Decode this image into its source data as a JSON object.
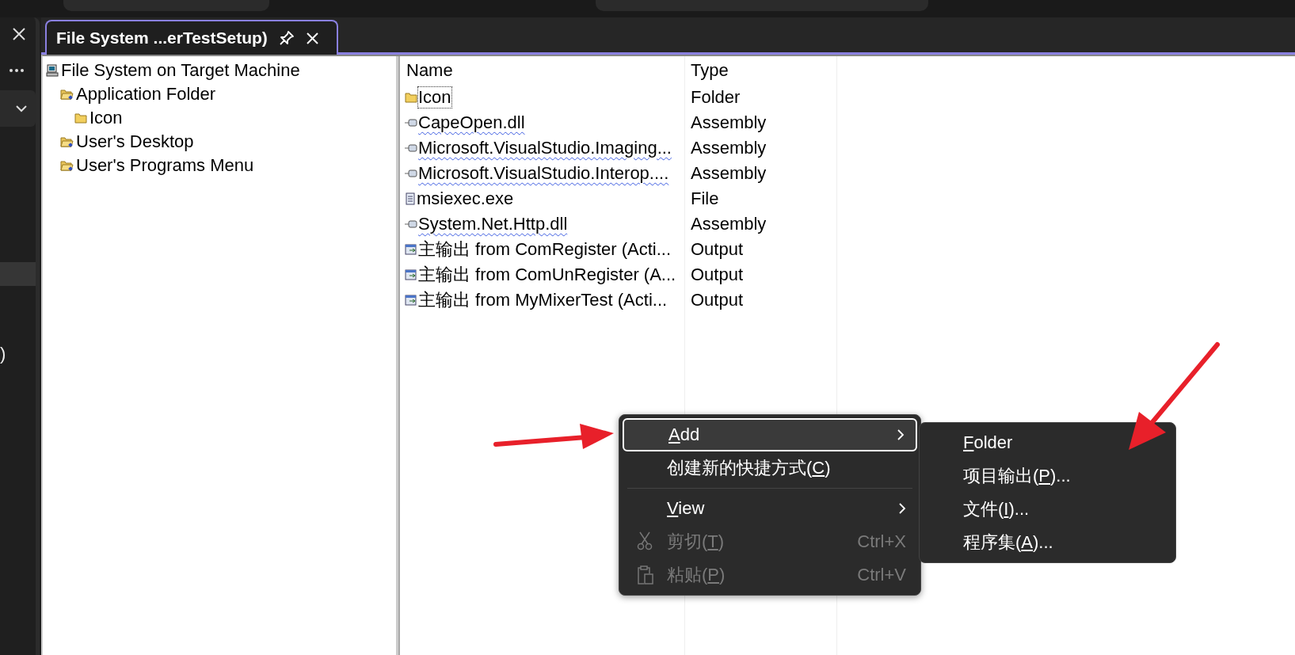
{
  "side_panel": {
    "text": ")"
  },
  "document_tab": {
    "title": "File System ...erTestSetup)",
    "selected": true
  },
  "tree": [
    {
      "label": "File System on Target Machine",
      "kind": "computer",
      "children": [
        {
          "label": "Application Folder",
          "kind": "special-folder",
          "children": [
            {
              "label": "Icon",
              "kind": "folder"
            }
          ]
        },
        {
          "label": "User's Desktop",
          "kind": "special-folder"
        },
        {
          "label": "User's Programs Menu",
          "kind": "special-folder"
        }
      ]
    }
  ],
  "table": {
    "columns": [
      "Name",
      "Type"
    ],
    "rows": [
      {
        "name": "Icon",
        "type": "Folder",
        "kind": "folder",
        "focused": true,
        "warning": false
      },
      {
        "name": "CapeOpen.dll",
        "type": "Assembly",
        "kind": "assembly",
        "focused": false,
        "warning": true
      },
      {
        "name": "Microsoft.VisualStudio.Imaging...",
        "type": "Assembly",
        "kind": "assembly",
        "focused": false,
        "warning": true
      },
      {
        "name": "Microsoft.VisualStudio.Interop....",
        "type": "Assembly",
        "kind": "assembly",
        "focused": false,
        "warning": true
      },
      {
        "name": "msiexec.exe",
        "type": "File",
        "kind": "file",
        "focused": false,
        "warning": false
      },
      {
        "name": "System.Net.Http.dll",
        "type": "Assembly",
        "kind": "assembly",
        "focused": false,
        "warning": true
      },
      {
        "name": "主输出 from ComRegister (Acti...",
        "type": "Output",
        "kind": "output",
        "focused": false,
        "warning": false
      },
      {
        "name": "主输出 from ComUnRegister (A...",
        "type": "Output",
        "kind": "output",
        "focused": false,
        "warning": false
      },
      {
        "name": "主输出 from MyMixerTest (Acti...",
        "type": "Output",
        "kind": "output",
        "focused": false,
        "warning": false
      }
    ]
  },
  "context_menu": {
    "items": [
      {
        "kind": "submenu",
        "key": "A",
        "after": "dd",
        "selected": true,
        "disabled": false
      },
      {
        "kind": "item",
        "before": "创建新的快捷方式(",
        "key": "C",
        "after": ")",
        "selected": false,
        "disabled": false
      },
      {
        "kind": "separator"
      },
      {
        "kind": "submenu",
        "key": "V",
        "after": "iew",
        "selected": false,
        "disabled": false
      },
      {
        "kind": "cut",
        "before": "剪切(",
        "key": "T",
        "after": ")",
        "shortcut": "Ctrl+X",
        "selected": false,
        "disabled": true
      },
      {
        "kind": "paste",
        "before": "粘贴(",
        "key": "P",
        "after": ")",
        "shortcut": "Ctrl+V",
        "selected": false,
        "disabled": true
      }
    ]
  },
  "submenu": {
    "items": [
      {
        "key": "F",
        "after": "older"
      },
      {
        "before": "项目输出(",
        "key": "P",
        "after": ")..."
      },
      {
        "before": "文件(",
        "key": "I",
        "after": ")..."
      },
      {
        "before": "程序集(",
        "key": "A",
        "after": ")..."
      }
    ]
  }
}
